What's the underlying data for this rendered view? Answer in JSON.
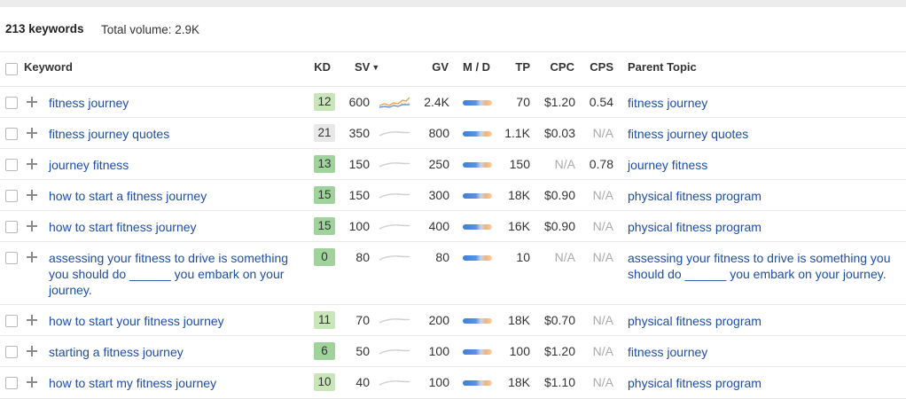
{
  "summary": {
    "keywords_count": "213 keywords",
    "total_volume": "Total volume: 2.9K"
  },
  "headers": {
    "keyword": "Keyword",
    "kd": "KD",
    "sv": "SV",
    "gv": "GV",
    "md": "M / D",
    "tp": "TP",
    "cpc": "CPC",
    "cps": "CPS",
    "parent_topic": "Parent Topic"
  },
  "colors": {
    "link": "#1f4ea3",
    "kd_green": "#9fd39b",
    "kd_light_green": "#c8e6b8",
    "kd_gray": "#e8e8e8",
    "trend_up": "#f0a24a"
  },
  "rows": [
    {
      "keyword": "fitness journey",
      "kd": "12",
      "kd_color": "#c8e6b8",
      "sv": "600",
      "trend": "up",
      "gv": "2.4K",
      "tp": "70",
      "cpc": "$1.20",
      "cps": "0.54",
      "parent_topic": "fitness journey"
    },
    {
      "keyword": "fitness journey quotes",
      "kd": "21",
      "kd_color": "#e8e8e8",
      "sv": "350",
      "trend": "flat",
      "gv": "800",
      "tp": "1.1K",
      "cpc": "$0.03",
      "cps": "N/A",
      "parent_topic": "fitness journey quotes"
    },
    {
      "keyword": "journey fitness",
      "kd": "13",
      "kd_color": "#9fd39b",
      "sv": "150",
      "trend": "flat",
      "gv": "250",
      "tp": "150",
      "cpc": "N/A",
      "cps": "0.78",
      "parent_topic": "journey fitness"
    },
    {
      "keyword": "how to start a fitness journey",
      "kd": "15",
      "kd_color": "#9fd39b",
      "sv": "150",
      "trend": "flat",
      "gv": "300",
      "tp": "18K",
      "cpc": "$0.90",
      "cps": "N/A",
      "parent_topic": "physical fitness program"
    },
    {
      "keyword": "how to start fitness journey",
      "kd": "15",
      "kd_color": "#9fd39b",
      "sv": "100",
      "trend": "flat",
      "gv": "400",
      "tp": "16K",
      "cpc": "$0.90",
      "cps": "N/A",
      "parent_topic": "physical fitness program"
    },
    {
      "keyword": "assessing your fitness to drive is something you should do ______ you embark on your journey.",
      "kd": "0",
      "kd_color": "#9fd39b",
      "sv": "80",
      "trend": "flat",
      "gv": "80",
      "tp": "10",
      "cpc": "N/A",
      "cps": "N/A",
      "parent_topic": "assessing your fitness to drive is something you should do ______ you embark on your journey."
    },
    {
      "keyword": "how to start your fitness journey",
      "kd": "11",
      "kd_color": "#c8e6b8",
      "sv": "70",
      "trend": "flat",
      "gv": "200",
      "tp": "18K",
      "cpc": "$0.70",
      "cps": "N/A",
      "parent_topic": "physical fitness program"
    },
    {
      "keyword": "starting a fitness journey",
      "kd": "6",
      "kd_color": "#9fd39b",
      "sv": "50",
      "trend": "flat",
      "gv": "100",
      "tp": "100",
      "cpc": "$1.20",
      "cps": "N/A",
      "parent_topic": "fitness journey"
    },
    {
      "keyword": "how to start my fitness journey",
      "kd": "10",
      "kd_color": "#c8e6b8",
      "sv": "40",
      "trend": "flat",
      "gv": "100",
      "tp": "18K",
      "cpc": "$1.10",
      "cps": "N/A",
      "parent_topic": "physical fitness program"
    }
  ]
}
